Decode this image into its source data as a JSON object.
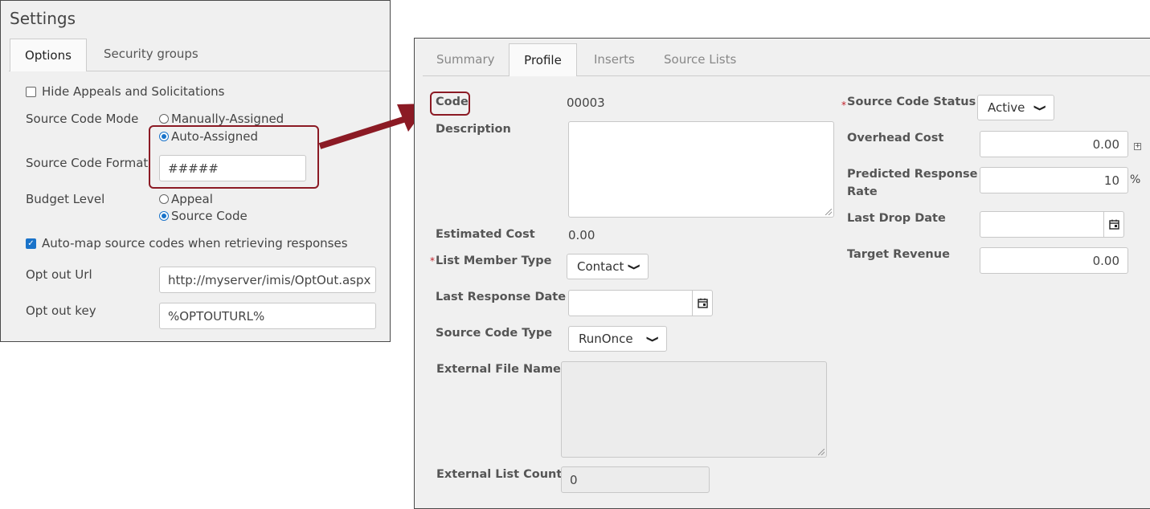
{
  "settings": {
    "title": "Settings",
    "tabs": [
      "Options",
      "Security groups"
    ],
    "hide_appeals_label": "Hide Appeals and Solicitations",
    "source_code_mode_label": "Source Code Mode",
    "mode_manual": "Manually-Assigned",
    "mode_auto": "Auto-Assigned",
    "source_code_format_label": "Source Code Format",
    "source_code_format_value": "#####",
    "budget_level_label": "Budget Level",
    "budget_appeal": "Appeal",
    "budget_source_code": "Source Code",
    "automap_label": "Auto-map source codes when retrieving responses",
    "opt_out_url_label": "Opt out Url",
    "opt_out_url_value": "http://myserver/imis/OptOut.aspx",
    "opt_out_key_label": "Opt out key",
    "opt_out_key_value": "%OPTOUTURL%"
  },
  "profile": {
    "tabs": [
      "Summary",
      "Profile",
      "Inserts",
      "Source Lists"
    ],
    "code_label": "Code",
    "code_value": "00003",
    "description_label": "Description",
    "estimated_cost_label": "Estimated Cost",
    "estimated_cost_value": "0.00",
    "list_member_type_label": "List Member Type",
    "list_member_type_value": "Contact",
    "last_response_date_label": "Last Response Date",
    "source_code_type_label": "Source Code Type",
    "source_code_type_value": "RunOnce",
    "external_file_name_label": "External File Name",
    "external_list_count_label": "External List Count",
    "external_list_count_value": "0",
    "source_code_status_label": "Source Code Status",
    "source_code_status_value": "Active",
    "overhead_cost_label": "Overhead Cost",
    "overhead_cost_value": "0.00",
    "predicted_response_rate_label_1": "Predicted Response",
    "predicted_response_rate_label_2": "Rate",
    "predicted_response_rate_value": "10",
    "percent_sign": "%",
    "last_drop_date_label": "Last Drop Date",
    "target_revenue_label": "Target Revenue",
    "target_revenue_value": "0.00",
    "required_marker": "*"
  },
  "colors": {
    "highlight": "#8b1a24",
    "accent": "#1a73c9"
  }
}
